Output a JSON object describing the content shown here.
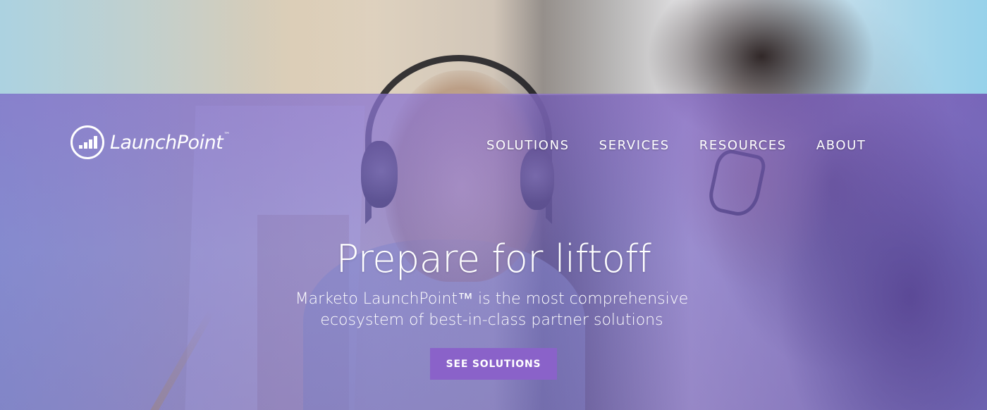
{
  "brand": {
    "name": "LaunchPoint",
    "trademark": "™"
  },
  "nav": {
    "items": [
      {
        "label": "SOLUTIONS"
      },
      {
        "label": "SERVICES"
      },
      {
        "label": "RESOURCES"
      },
      {
        "label": "ABOUT"
      }
    ]
  },
  "hero": {
    "headline": "Prepare for liftoff",
    "subhead_line1": "Marketo LaunchPoint™ is the most comprehensive",
    "subhead_line2": "ecosystem of best-in-class partner solutions",
    "cta_label": "SEE SOLUTIONS"
  },
  "colors": {
    "overlay": "#8c6ec8",
    "cta": "#8a62c9",
    "text": "#ffffff"
  },
  "icons": {
    "logo": "launchpoint-logo-icon"
  }
}
